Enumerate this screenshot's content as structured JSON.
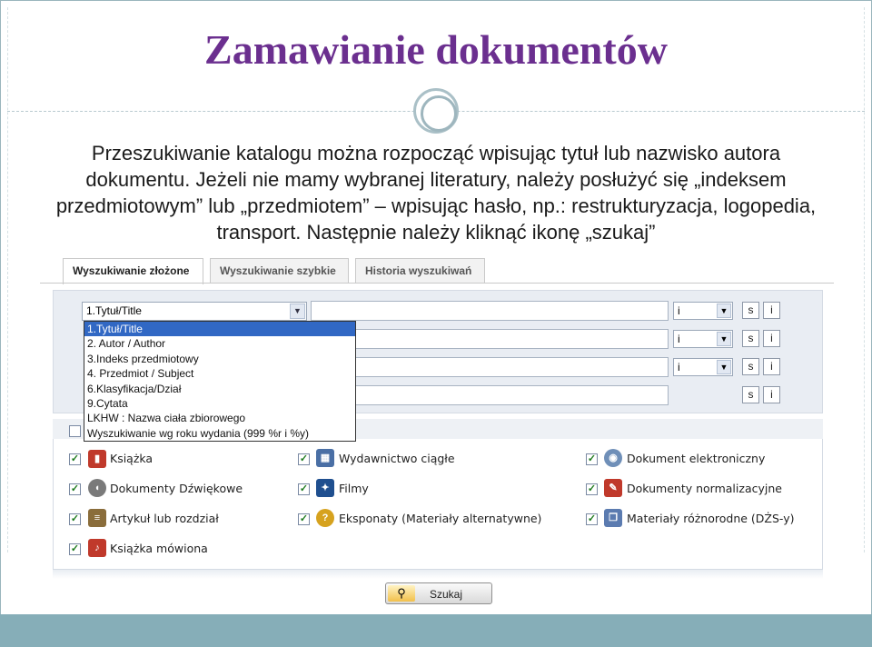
{
  "slide": {
    "title": "Zamawianie dokumentów",
    "paragraph": "Przeszukiwanie katalogu można rozpocząć wpisując tytuł lub nazwisko autora dokumentu. Jeżeli nie mamy wybranej literatury, należy posłużyć się „indeksem przedmiotowym” lub „przedmiotem” – wpisując hasło, np.: restrukturyzacja, logopedia, transport. Następnie należy kliknąć ikonę „szukaj”"
  },
  "tabs": [
    {
      "label": "Wyszukiwanie złożone"
    },
    {
      "label": "Wyszukiwanie szybkie"
    },
    {
      "label": "Historia wyszukiwań"
    }
  ],
  "search": {
    "field_value": "1.Tytuł/Title",
    "operator_value": "i",
    "s_label": "s",
    "i_label": "i",
    "options": [
      "1.Tytuł/Title",
      "2. Autor / Author",
      "3.Indeks przedmiotowy",
      "4. Przedmiot / Subject",
      "6.Klasyfikacja/Dział",
      "9.Cytata",
      "LKHW : Nazwa ciała zbiorowego",
      "Wyszukiwanie wg roku wydania (999 %r i %y)"
    ]
  },
  "types": {
    "col1": [
      "Książka",
      "Dokumenty Dźwiękowe",
      "Artykuł lub rozdział",
      "Książka mówiona"
    ],
    "col2": [
      "Wydawnictwo ciągłe",
      "Filmy",
      "Eksponaty (Materiały alternatywne)"
    ],
    "col3": [
      "Dokument elektroniczny",
      "Dokumenty normalizacyjne",
      "Materiały różnorodne (DŻS-y)"
    ]
  },
  "button": {
    "search_label": "Szukaj"
  },
  "icons": {
    "book": "book-icon",
    "speaker": "speaker-icon",
    "article": "article-icon",
    "audiobook": "audiobook-icon",
    "serial": "calendar-icon",
    "film": "film-icon",
    "exhibit": "exhibit-icon",
    "cd": "cd-icon",
    "standard": "standard-doc-icon",
    "mixed": "mixed-materials-icon",
    "magnifier": "magnifier-icon"
  },
  "colors": {
    "title": "#6b2f8f",
    "footer": "#86aeb8",
    "selection": "#3168c4"
  }
}
